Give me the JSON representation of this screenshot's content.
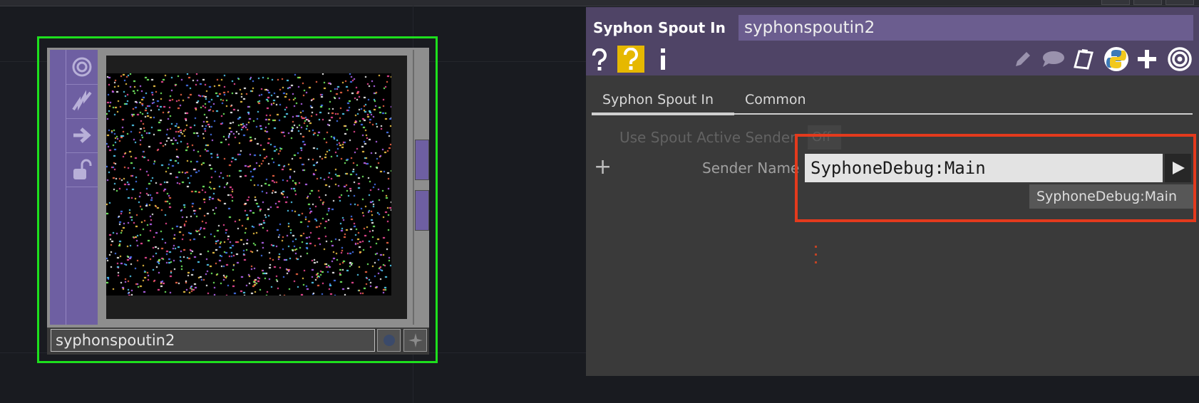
{
  "node": {
    "name": "syphonspoutin2"
  },
  "panel": {
    "op_type": "Syphon Spout In",
    "op_name": "syphonspoutin2",
    "header_icons": [
      "help-icon",
      "python-help-icon",
      "info-icon",
      "edit-icon",
      "comment-icon",
      "clipboard-icon",
      "python-icon",
      "plus-icon",
      "target-icon"
    ],
    "tabs": [
      "Syphon Spout In",
      "Common"
    ],
    "params": {
      "use_spout_active_sender_label": "Use Spout Active Sender",
      "use_spout_active_sender_value": "Off",
      "sender_name_label": "Sender Name",
      "sender_name_value": "SyphoneDebug:Main"
    },
    "tooltip": "SyphoneDebug:Main"
  },
  "colors": {
    "selection": "#1de01d",
    "operator_purple": "#6e5fa2",
    "header_purple": "#4f4466",
    "highlight_red": "#e33a1d"
  }
}
